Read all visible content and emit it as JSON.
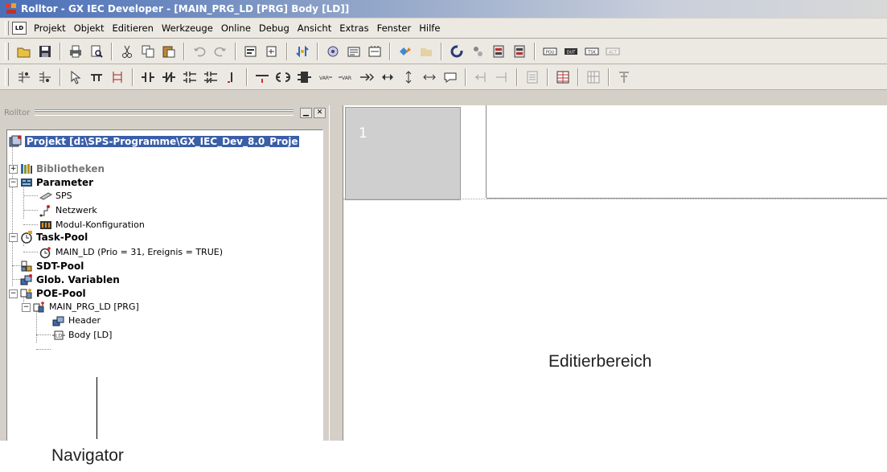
{
  "window": {
    "title": "Rolltor - GX IEC Developer - [MAIN_PRG_LD [PRG] Body [LD]]"
  },
  "menubar": {
    "mdi_icon_label": "LD",
    "items": [
      {
        "label": "Projekt"
      },
      {
        "label": "Objekt"
      },
      {
        "label": "Editieren"
      },
      {
        "label": "Werkzeuge"
      },
      {
        "label": "Online"
      },
      {
        "label": "Debug"
      },
      {
        "label": "Ansicht"
      },
      {
        "label": "Extras"
      },
      {
        "label": "Fenster"
      },
      {
        "label": "Hilfe"
      }
    ]
  },
  "navigator": {
    "pane_title": "Rolltor",
    "tree": [
      {
        "label": "Projekt [d:\\SPS-Programme\\GX_IEC_Dev_8.0_Proje",
        "style": "selected"
      },
      {
        "label": "Bibliotheken",
        "style": "bold-gray"
      },
      {
        "label": "Parameter",
        "style": "bold"
      },
      {
        "label": "SPS",
        "style": "small"
      },
      {
        "label": "Netzwerk",
        "style": "small"
      },
      {
        "label": "Modul-Konfiguration",
        "style": "small"
      },
      {
        "label": "Task-Pool",
        "style": "bold"
      },
      {
        "label": "MAIN_LD (Prio = 31, Ereignis = TRUE)",
        "style": "small"
      },
      {
        "label": "SDT-Pool",
        "style": "bold"
      },
      {
        "label": "Glob. Variablen",
        "style": "bold"
      },
      {
        "label": "POE-Pool",
        "style": "bold"
      },
      {
        "label": "MAIN_PRG_LD [PRG]",
        "style": "small"
      },
      {
        "label": "Header",
        "style": "small"
      },
      {
        "label": "Body [LD]",
        "style": "small"
      }
    ]
  },
  "editor": {
    "network_number": "1"
  },
  "annotations": {
    "editor_label": "Editierbereich",
    "navigator_label": "Navigator"
  },
  "colors": {
    "title_gradient_start": "#4a6fb8",
    "selection": "#3a5ea8",
    "window_face": "#d4d0c8"
  }
}
